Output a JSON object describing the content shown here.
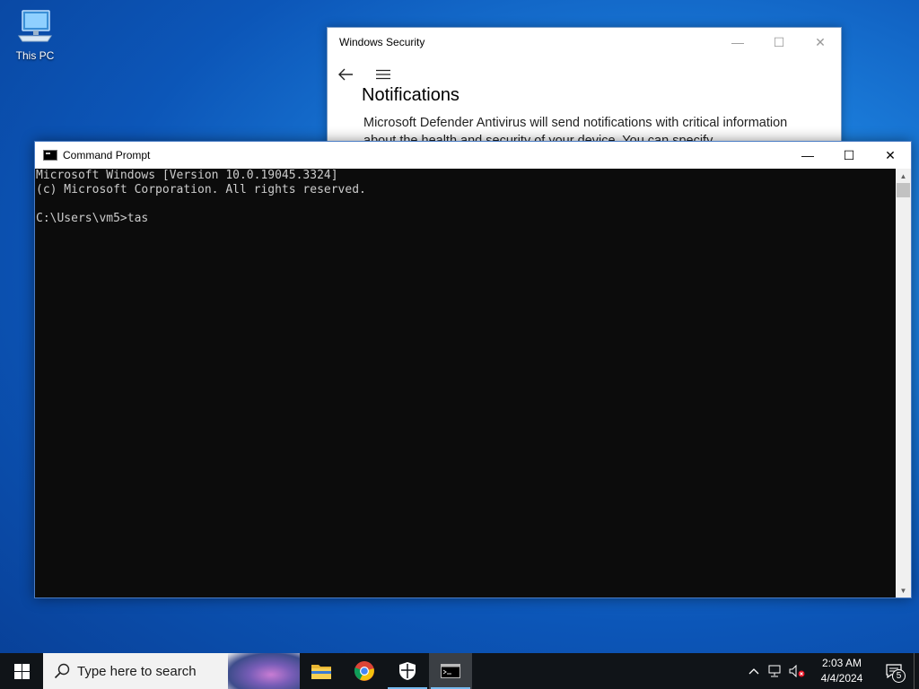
{
  "desktop": {
    "icons": [
      {
        "label": "This PC",
        "icon": "this-pc-icon"
      }
    ]
  },
  "security_window": {
    "title": "Windows Security",
    "heading": "Notifications",
    "body": "Microsoft Defender Antivirus will send notifications with critical information about the health and security of your device. You can specify",
    "controls": {
      "minimize": "—",
      "maximize": "☐",
      "close": "✕"
    }
  },
  "cmd_window": {
    "title": "Command Prompt",
    "controls": {
      "minimize": "—",
      "maximize": "☐",
      "close": "✕"
    },
    "console_lines": [
      "Microsoft Windows [Version 10.0.19045.3324]",
      "(c) Microsoft Corporation. All rights reserved.",
      "",
      "C:\\Users\\vm5>tas"
    ]
  },
  "taskbar": {
    "search_placeholder": "Type here to search",
    "apps": [
      {
        "name": "File Explorer",
        "icon": "folder-icon"
      },
      {
        "name": "Google Chrome",
        "icon": "chrome-icon"
      },
      {
        "name": "Windows Security",
        "icon": "shield-icon",
        "running": true
      },
      {
        "name": "Command Prompt",
        "icon": "cmd-icon",
        "active": true
      }
    ],
    "clock": {
      "time": "2:03 AM",
      "date": "4/4/2024"
    },
    "notification_count": "5"
  },
  "colors": {
    "taskbar_bg": "#101418",
    "console_bg": "#0c0c0c",
    "console_fg": "#cccccc",
    "accent": "#76b9ed"
  }
}
